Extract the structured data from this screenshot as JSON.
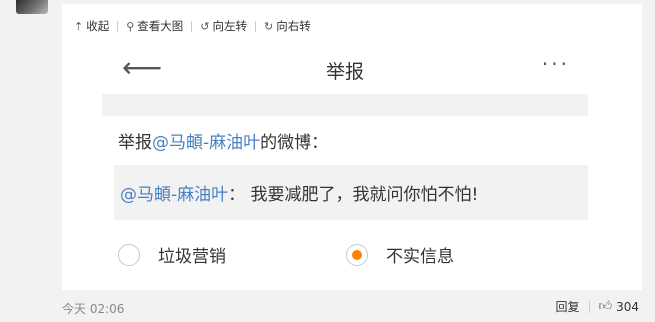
{
  "toolbar": {
    "collapse": {
      "icon": "collapse-up-arrow",
      "label": "收起"
    },
    "view_large": {
      "icon": "magnifier",
      "label": "查看大图"
    },
    "rotate_left": {
      "icon": "rotate-left",
      "label": "向左转"
    },
    "rotate_right": {
      "icon": "rotate-right",
      "label": "向右转"
    }
  },
  "screenshot": {
    "nav_title": "举报",
    "back_icon": "back-arrow",
    "more_icon": "more-dots",
    "report_prefix": "举报",
    "report_user": "@马頔-麻油叶",
    "report_suffix": "的微博：",
    "quote_user": "@马頔-麻油叶",
    "quote_text": "：  我要减肥了，我就问你怕不怕!",
    "options": [
      {
        "label": "垃圾营销",
        "selected": false
      },
      {
        "label": "不实信息",
        "selected": true
      }
    ],
    "accent_color": "#ff8200",
    "link_color": "#4a7fc3"
  },
  "footer": {
    "time": "今天 02:06",
    "reply": "回复",
    "like_count": "304",
    "like_icon": "thumbs-up"
  }
}
